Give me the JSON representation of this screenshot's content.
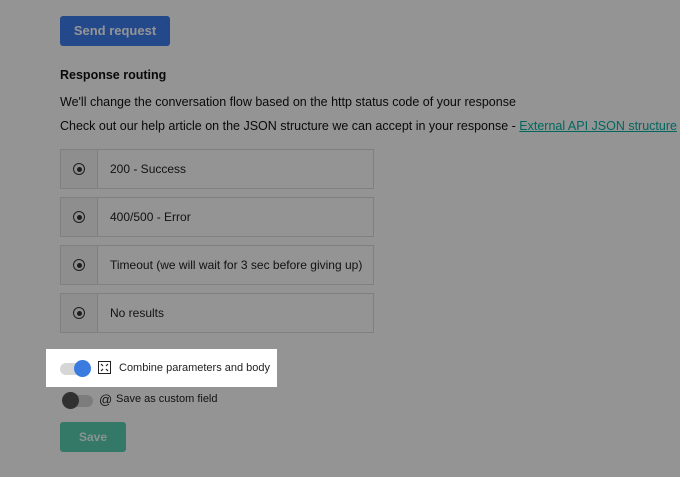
{
  "send_button": {
    "label": "Send request"
  },
  "response_routing": {
    "title": "Response routing",
    "description": "We'll change the conversation flow based on the http status code of your response",
    "help_prefix": "Check out our help article on the JSON structure we can accept in your response - ",
    "help_link": "External API JSON structure",
    "options": [
      {
        "label": "200 - Success"
      },
      {
        "label": "400/500 - Error"
      },
      {
        "label": "Timeout (we will wait for 3 sec before giving up)"
      },
      {
        "label": "No results"
      }
    ]
  },
  "toggles": {
    "combine": {
      "label": "Combine parameters and body",
      "icon": "expand-icon",
      "state": "on"
    },
    "custom_field": {
      "label": "Save as custom field",
      "icon": "at-icon",
      "state": "off"
    }
  },
  "save_button": {
    "label": "Save"
  },
  "colors": {
    "primary": "#3e7ff0",
    "link": "#00b3a4",
    "toggle_on": "#3a7be0",
    "save": "#3fc7a6"
  }
}
